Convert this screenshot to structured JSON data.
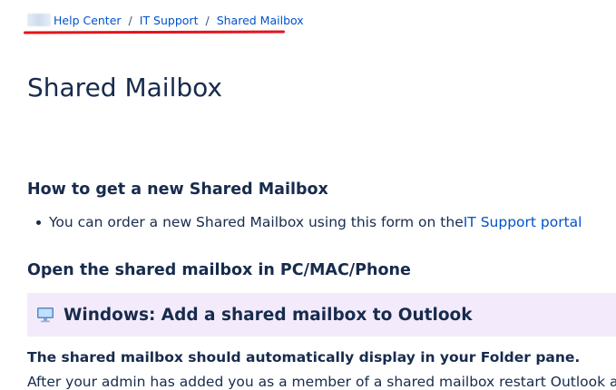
{
  "breadcrumb": {
    "items": [
      "Help Center",
      "IT Support",
      "Shared Mailbox"
    ],
    "separator": "/"
  },
  "page": {
    "title": "Shared Mailbox"
  },
  "sections": {
    "get_heading": "How to get a new Shared Mailbox",
    "get_bullet_text": "You can order a new Shared Mailbox using this form on the ",
    "get_bullet_link": "IT Support portal",
    "open_heading": "Open the shared mailbox in PC/MAC/Phone"
  },
  "panel": {
    "icon": "computer-monitor-icon",
    "title": "Windows: Add a shared mailbox to Outlook",
    "background": "#f3ebfb"
  },
  "body": {
    "bold_line": "The shared mailbox should automatically display in your Folder pane.",
    "cut_line": "After your admin has added you as a member of a shared mailbox restart Outlook and"
  },
  "colors": {
    "link": "#0052cc",
    "text": "#172b4d",
    "annotation": "#e3141d"
  }
}
